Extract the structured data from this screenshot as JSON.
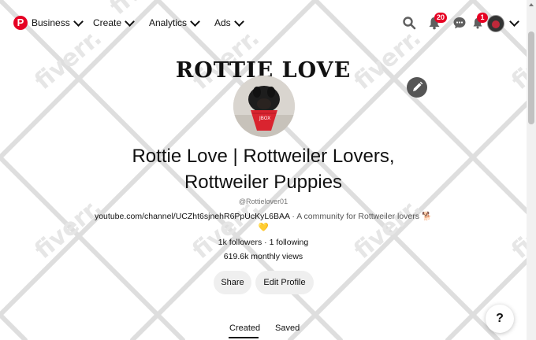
{
  "nav": {
    "logo": "P",
    "business": "Business",
    "create": "Create",
    "analytics": "Analytics",
    "ads": "Ads"
  },
  "topbar": {
    "notifications_count": "20",
    "updates_count": "1",
    "icons": [
      "search-icon",
      "bell-icon",
      "chat-icon",
      "updates-icon",
      "avatar",
      "chevron-down-icon"
    ]
  },
  "cover": {
    "title": "ROTTIE LOVE"
  },
  "profile": {
    "name_line1": "Rottie Love | Rottweiler Lovers,",
    "name_line2": "Rottweiler Puppies",
    "handle": "@Rottielover01",
    "website": "youtube.com/channel/UCZht6sjnehR6PpUcKyL6BAA",
    "separator": "·",
    "description": "A community for Rottweiler lovers",
    "emoji_dog": "🐕",
    "emoji_heart": "💛",
    "followers": "1k followers",
    "following": "1 following",
    "monthly_views": "619.6k monthly views"
  },
  "actions": {
    "share": "Share",
    "edit_profile": "Edit Profile"
  },
  "tabs": {
    "created": "Created",
    "saved": "Saved"
  },
  "help": "?",
  "watermark": "fiverr.",
  "colors": {
    "brand": "#e60023",
    "button_bg": "#efefef"
  }
}
